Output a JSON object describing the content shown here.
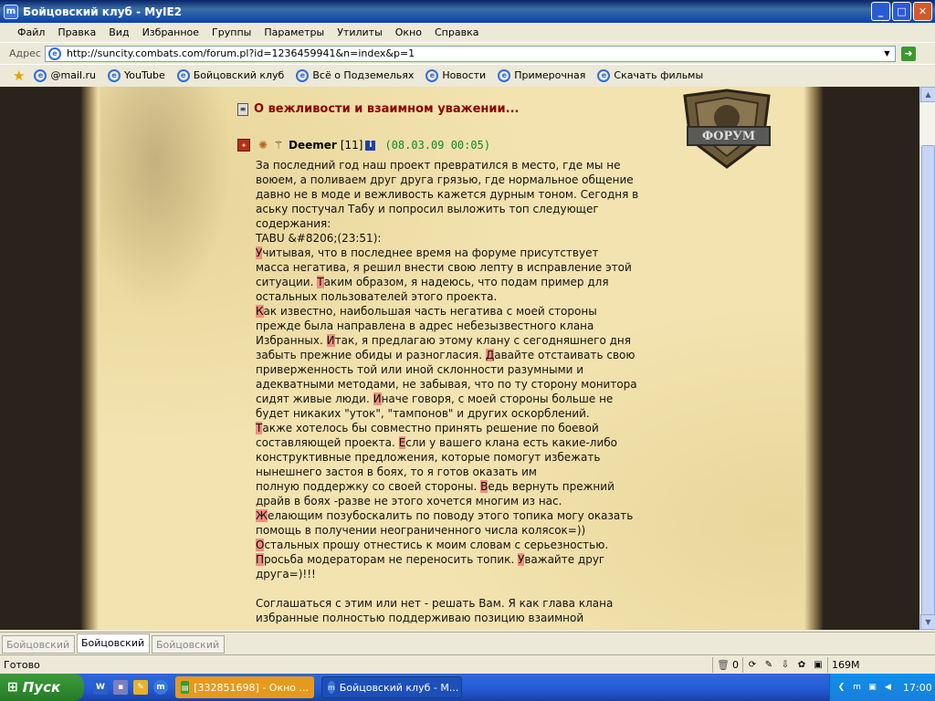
{
  "window": {
    "title": "Бойцовский клуб - MyIE2"
  },
  "menu": [
    "Файл",
    "Правка",
    "Вид",
    "Избранное",
    "Группы",
    "Параметры",
    "Утилиты",
    "Окно",
    "Справка"
  ],
  "address": {
    "label": "Адрес",
    "url": "http://suncity.combats.com/forum.pl?id=1236459941&n=index&p=1"
  },
  "links": [
    "@mail.ru",
    "YouTube",
    "Бойцовский клуб",
    "Всё о Подземельях",
    "Новости",
    "Примерочная",
    "Скачать фильмы"
  ],
  "forum": {
    "logo_label": "ФОРУМ",
    "topic_title": "О вежливости и взаимном уважении...",
    "author": "Deemer",
    "level": "[11]",
    "date": "(08.03.09 00:05)",
    "lines": [
      "За последний год наш проект превратился в место, где мы не",
      "воюем, а поливаем друг друга грязью, где нормальное общение",
      "давно не в моде и вежливость кажется дурным тоном. Сегодня в",
      "аську постучал Табу и попросил выложить топ следующег",
      "содержания:",
      "TABU &#8206;(23:51):",
      "Учитывая, что в последнее время на форуме присутствует",
      "масса негатива, я решил внести свою лепту в исправление этой",
      "ситуации. Таким образом, я надеюсь, что подам пример для",
      "остальных пользователей этого проекта.",
      "Как известно, наибольшая часть негатива с моей стороны",
      "прежде была направлена в адрес небезызвестного клана",
      "Избранных. Итак, я предлагаю этому клану с сегодняшнего дня",
      "забыть прежние обиды и разногласия. Давайте отстаивать свою",
      "приверженность той или иной склонности разумными и",
      "адекватными методами, не забывая, что по ту сторону монитора",
      "сидят живые люди. Иначе говоря, с моей стороны больше не",
      "будет никаких \"уток\", \"тампонов\" и других оскорблений.",
      "Также хотелось бы совместно принять решение по боевой",
      "составляющей проекта. Если у вашего клана есть какие-либо",
      "конструктивные предложения, которые помогут избежать",
      "нынешнего застоя в боях, то я готов оказать им",
      "полную поддержку со своей стороны. Ведь вернуть прежний",
      "драйв в боях -разве не этого хочется многим из нас.",
      "Желающим позубоскалить по поводу этого топика могу оказать",
      "помощь в получении неограниченного числа колясок=))",
      "Остальных прошу отнестись к моим словам с серьезностью.",
      "Просьба модераторам не переносить топик. Уважайте друг",
      "друга=)!!!",
      "",
      "Соглашаться с этим или нет - решать Вам. Я как глава клана",
      "избранные полностью поддерживаю позицию взаимной"
    ]
  },
  "tabs": [
    "Бойцовский ...",
    "Бойцовский ...",
    "Бойцовский ..."
  ],
  "status": {
    "text": "Готово",
    "trash_count": "0",
    "memory": "169M"
  },
  "taskbar": {
    "start": "Пуск",
    "tasks": [
      "[332851698] - Окно ...",
      "Бойцовский клуб - М..."
    ],
    "clock": "17:00"
  },
  "icons": {
    "app": "myie2-icon",
    "go": "go-arrow-icon",
    "favorite": "star-icon",
    "link": "ie-page-icon",
    "topic": "scroll-icon",
    "info": "info-icon"
  },
  "colors": {
    "title_red": "#8b0000",
    "date_green": "#0a8a2a",
    "highlight": "#ee8f80",
    "parchment": "#f3e3b0"
  }
}
